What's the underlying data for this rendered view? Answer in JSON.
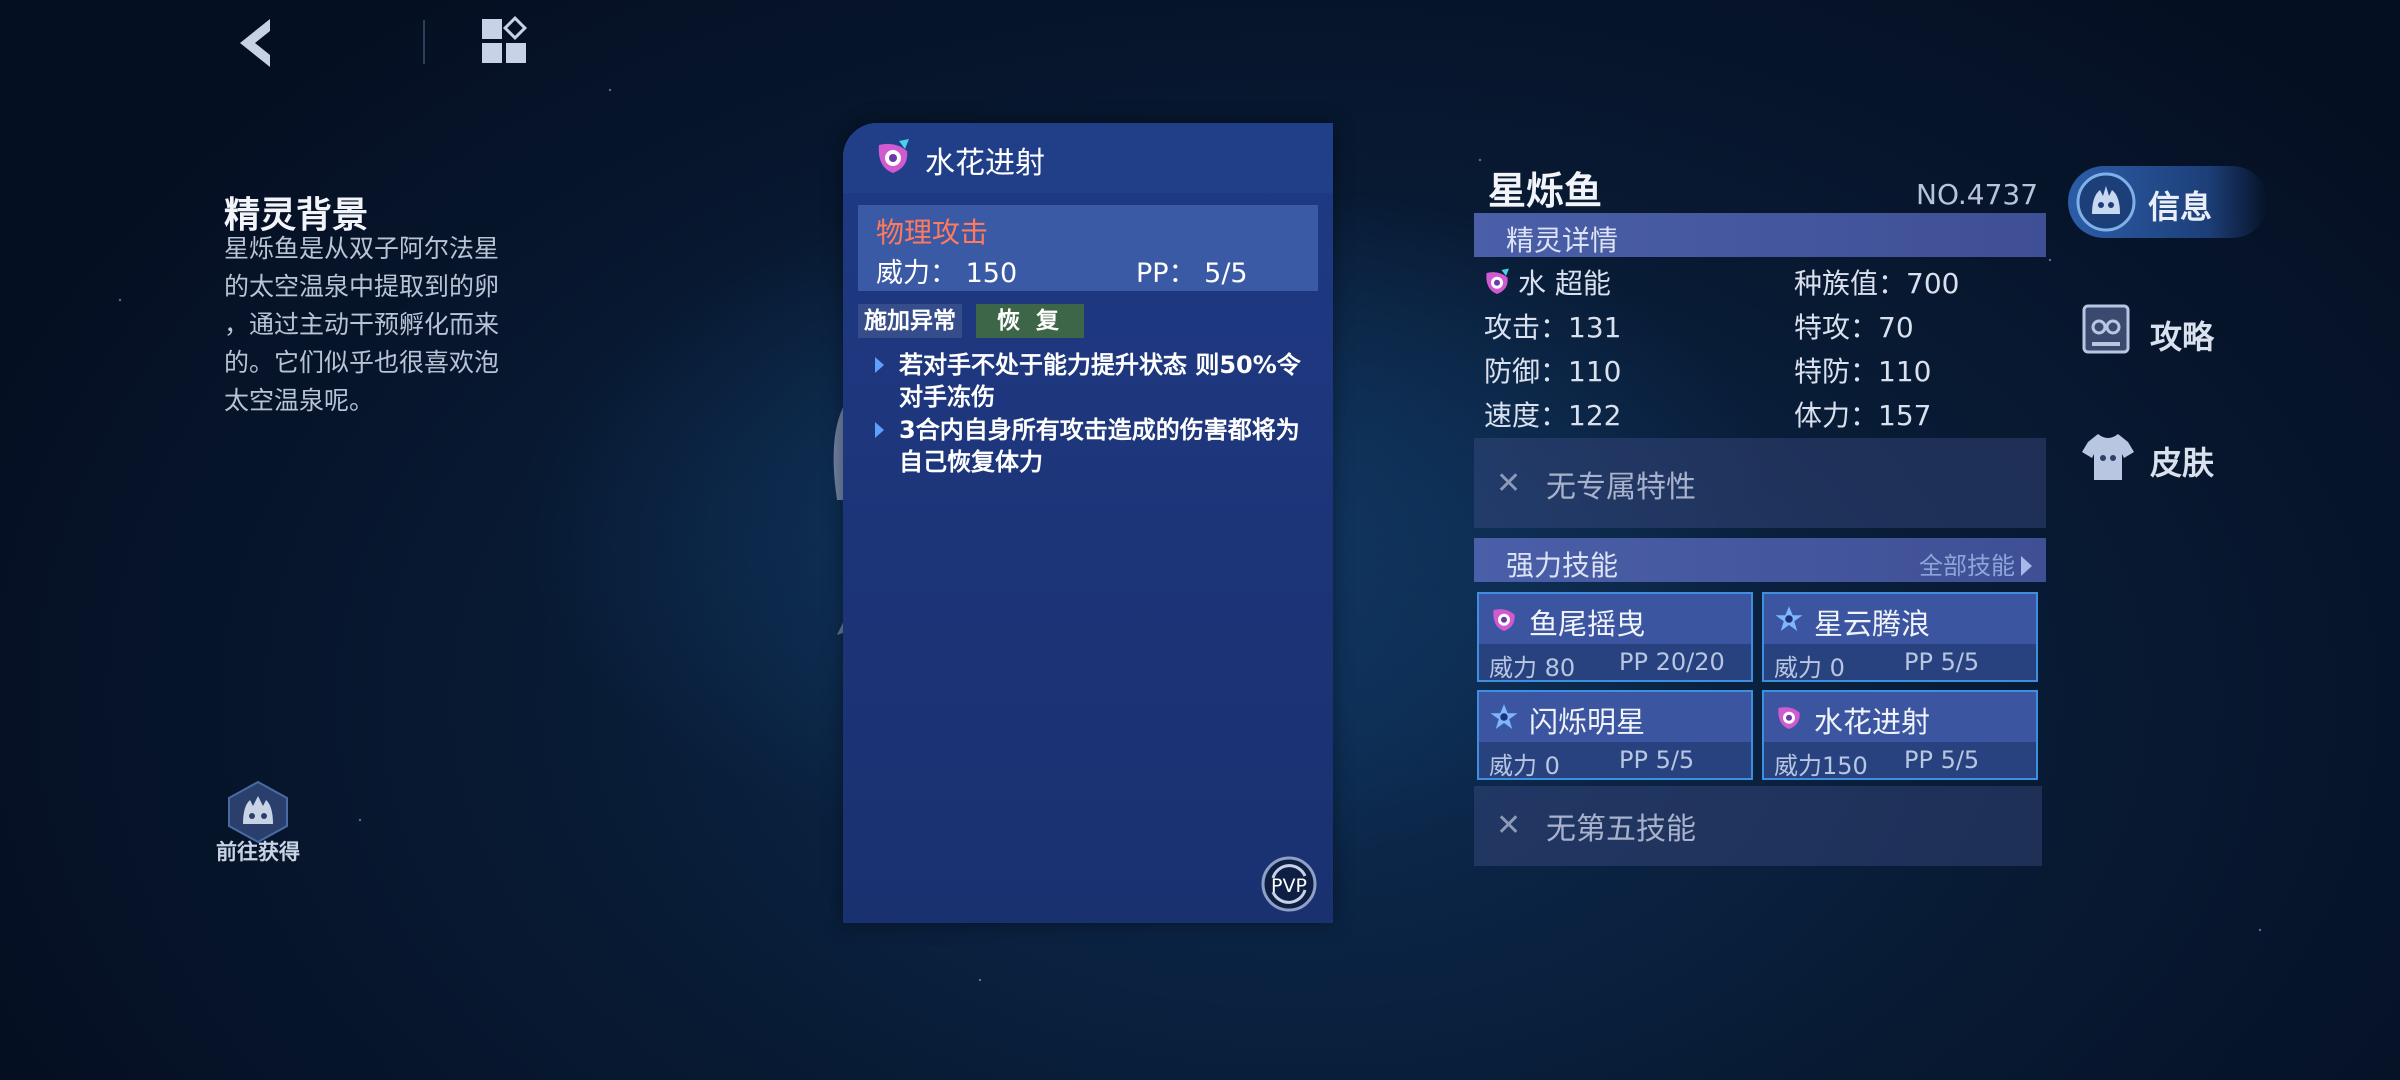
{
  "nav": {
    "back_icon": "chevron-left-icon",
    "menu_icon": "grid-menu-icon"
  },
  "background": {
    "title": "精灵背景",
    "lines": [
      "星烁鱼是从双子阿尔法星",
      "的太空温泉中提取到的卵",
      "，通过主动干预孵化而来",
      "的。它们似乎也很喜欢泡",
      "太空温泉呢。"
    ]
  },
  "obtain": {
    "label": "前往获得",
    "icon": "flame-face-icon"
  },
  "skill_card": {
    "title": "水花进射",
    "element_icon": "water-element-icon",
    "attack_type": "物理攻击",
    "power": "威力：  150",
    "pp": "PP：   5/5",
    "tags": [
      "施加异常",
      "恢 复"
    ],
    "effects": [
      "若对手不处于能力提升状态 则50%令对手冻伤",
      "3合内自身所有攻击造成的伤害都将为自己恢复体力"
    ],
    "pvp_label": "PVP"
  },
  "pet": {
    "name": "星烁鱼",
    "number": "NO.4737",
    "details_header": "精灵详情",
    "elements": "水 超能",
    "total": "种族值：700",
    "stats": {
      "atk": "攻击：131",
      "sp_atk": "特攻：70",
      "def": "防御：110",
      "sp_def": "特防：110",
      "speed": "速度：122",
      "hp": "体力：157"
    },
    "no_trait": "无专属特性",
    "skills_header": "强力技能",
    "all_skills": "全部技能",
    "skills": [
      {
        "name": "鱼尾摇曳",
        "power": "威力 80",
        "pp": "PP 20/20",
        "icon": "water-element-icon"
      },
      {
        "name": "星云腾浪",
        "power": "威力  0",
        "pp": "PP   5/5",
        "icon": "star-element-icon"
      },
      {
        "name": "闪烁明星",
        "power": "威力  0",
        "pp": "PP   5/5",
        "icon": "star-element-icon"
      },
      {
        "name": "水花进射",
        "power": "威力150",
        "pp": "PP   5/5",
        "icon": "water-element-icon"
      }
    ],
    "no_fifth": "无第五技能"
  },
  "tabs": [
    {
      "label": "信息",
      "icon": "info-face-icon"
    },
    {
      "label": "攻略",
      "icon": "guide-book-icon"
    },
    {
      "label": "皮肤",
      "icon": "shirt-icon"
    }
  ],
  "colors": {
    "accent": "#3f8fe0",
    "attack_type": "#ff7a5c",
    "recover_tag": "#3d6648"
  }
}
